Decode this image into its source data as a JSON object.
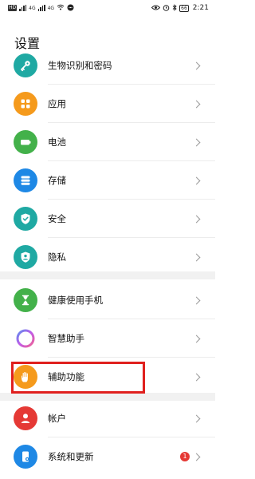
{
  "statusbar": {
    "left_icons": [
      "HD",
      "4G",
      "4G"
    ],
    "battery": "66",
    "time": "2:21"
  },
  "page": {
    "title": "设置"
  },
  "sections": [
    {
      "items": [
        {
          "label": "生物识别和密码",
          "icon": "key-icon",
          "color": "#1fa9a3"
        },
        {
          "label": "应用",
          "icon": "apps-grid-icon",
          "color": "#f59a1c"
        },
        {
          "label": "电池",
          "icon": "battery-icon",
          "color": "#43b14a"
        },
        {
          "label": "存储",
          "icon": "storage-icon",
          "color": "#1e88e5"
        },
        {
          "label": "安全",
          "icon": "shield-check-icon",
          "color": "#1fa9a3"
        },
        {
          "label": "隐私",
          "icon": "privacy-shield-icon",
          "color": "#1fa9a3"
        }
      ]
    },
    {
      "items": [
        {
          "label": "健康使用手机",
          "icon": "hourglass-icon",
          "color": "#43b14a"
        },
        {
          "label": "智慧助手",
          "icon": "assistant-ring-icon",
          "color": "#b06ee8"
        },
        {
          "label": "辅助功能",
          "icon": "hand-icon",
          "color": "#f59a1c"
        }
      ]
    },
    {
      "items": [
        {
          "label": "帐户",
          "icon": "account-icon",
          "color": "#e53935"
        },
        {
          "label": "系统和更新",
          "icon": "system-update-icon",
          "color": "#1e88e5",
          "badge": "1"
        }
      ]
    }
  ]
}
